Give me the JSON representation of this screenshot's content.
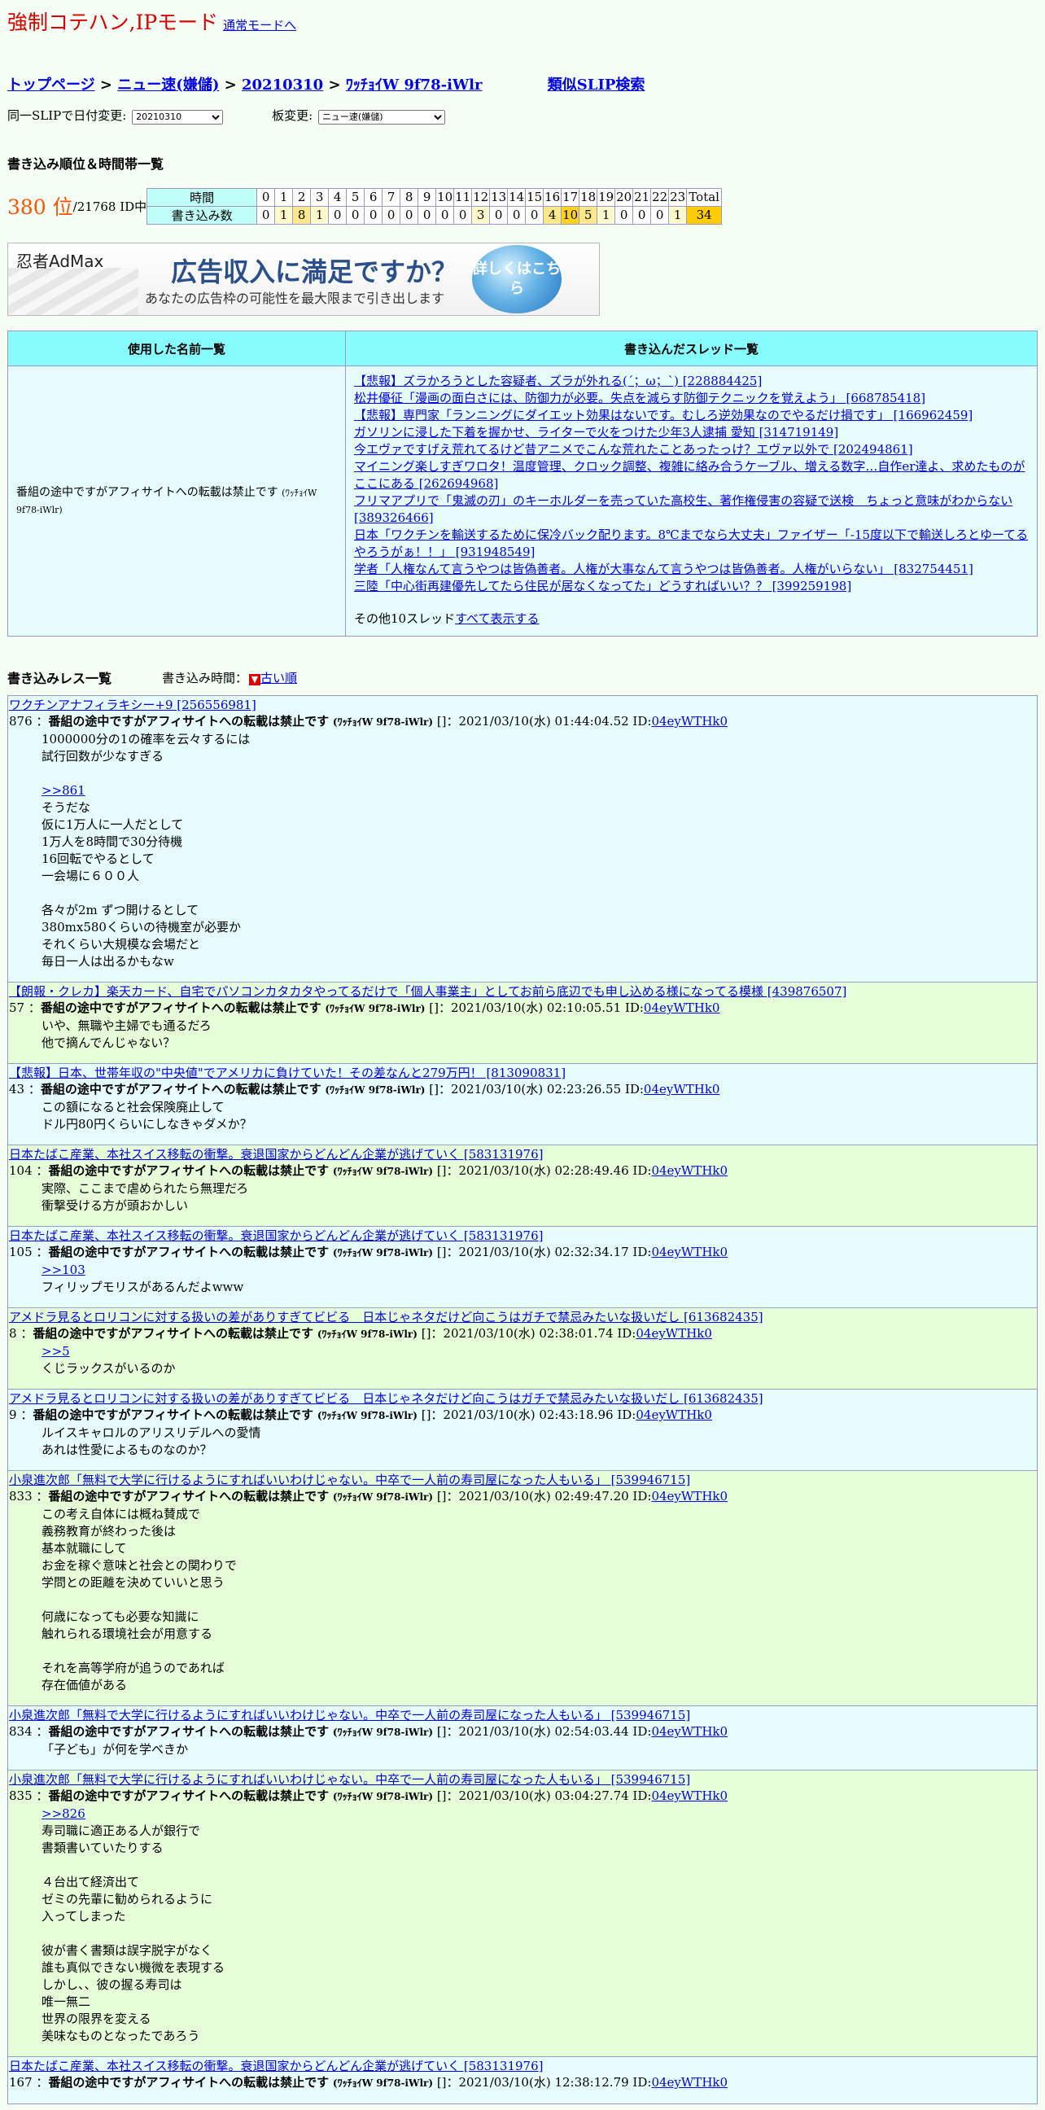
{
  "header": {
    "mode_title": "強制コテハン,IPモード",
    "mode_link": "通常モードへ"
  },
  "breadcrumb": {
    "top": "トップページ",
    "board": "ニュー速(嫌儲)",
    "date": "20210310",
    "slip": "ﾜｯﾁｮｲW 9f78-iWlr",
    "similar": "類似SLIP検索",
    "sep": ">"
  },
  "controls": {
    "date_label": "同一SLIPで日付変更:",
    "date_value": "20210310",
    "board_label": "板変更:",
    "board_value": "ニュー速(嫌儲)"
  },
  "ranking": {
    "section_title": "書き込み順位＆時間帯一覧",
    "rank": "380 位",
    "of": "/21768 ID中",
    "row_time_label": "時間",
    "row_count_label": "書き込み数",
    "hours": [
      "0",
      "1",
      "2",
      "3",
      "4",
      "5",
      "6",
      "7",
      "8",
      "9",
      "10",
      "11",
      "12",
      "13",
      "14",
      "15",
      "16",
      "17",
      "18",
      "19",
      "20",
      "21",
      "22",
      "23",
      "Total"
    ],
    "counts": [
      "0",
      "1",
      "8",
      "1",
      "0",
      "0",
      "0",
      "0",
      "0",
      "0",
      "0",
      "0",
      "3",
      "0",
      "0",
      "0",
      "4",
      "10",
      "5",
      "1",
      "0",
      "0",
      "0",
      "1",
      "34"
    ]
  },
  "ad": {
    "logo": "忍者AdMax",
    "title": "広告収入に満足ですか？",
    "subtitle": "あなたの広告枠の可能性を最大限まで引き出します",
    "button": "詳しくはこちら"
  },
  "names_table": {
    "col_names": "使用した名前一覧",
    "col_threads": "書き込んだスレッド一覧",
    "name": "番組の途中ですがアフィサイトへの転載は禁止です",
    "name_slip": "(ﾜｯﾁｮｲW 9f78-iWlr)",
    "threads": [
      "【悲報】ズラかろうとした容疑者、ズラが外れる(´；ω；`) [228884425]",
      "松井優征「漫画の面白さには、防御力が必要。失点を減らす防御テクニックを覚えよう」 [668785418]",
      "【悲報】専門家「ランニングにダイエット効果はないです。むしろ逆効果なのでやるだけ損です」 [166962459]",
      "ガソリンに浸した下着を握かせ、ライターで火をつけた少年3人逮捕 愛知 [314719149]",
      "今エヴァですげえ荒れてるけど昔アニメでこんな荒れたことあったっけ？エヴァ以外で [202494861]",
      "マイニング楽しすぎワロタ！温度管理、クロック調整、複雑に絡み合うケーブル、増える数字…自作er達よ、求めたものがここにある [262694968]",
      "フリマアプリで「鬼滅の刃」のキーホルダーを売っていた高校生、著作権侵害の容疑で送検　ちょっと意味がわからない [389326466]",
      "日本「ワクチンを輸送するために保冷バック配ります。8℃までなら大丈夫」ファイザー「-15度以下で輸送しろとゆーてるやろうがぁ！！」 [931948549]",
      "学者「人権なんて言うやつは皆偽善者。人権が大事なんて言うやつは皆偽善者。人権がいらない」 [832754451]",
      "三陸「中心街再建優先してたら住民が居なくなってた」どうすればいい？？ [399259198]"
    ],
    "more_prefix": "その他10スレッド",
    "more_link": "すべて表示する"
  },
  "posts_header": {
    "title": "書き込みレス一覧",
    "time_label": "書き込み時間：",
    "sort_icon": "▼",
    "sort_link": "古い順"
  },
  "posts": [
    {
      "thread": "ワクチンアナフィラキシー+9 [256556981]",
      "num": "876",
      "name": "番組の途中ですがアフィサイトへの転載は禁止です",
      "slip": "(ﾜｯﾁｮｲW 9f78-iWlr)",
      "mid": "[]：2021/03/10(水) 01:44:04.52 ID:",
      "id": "04eyWTHk0",
      "ref": "",
      "lines": [
        "1000000分の1の確率を云々するには",
        "試行回数が少なすぎる"
      ],
      "ref2": ">>861",
      "lines2": [
        "そうだな",
        "仮に1万人に一人だとして",
        "1万人を8時間で30分待機",
        "16回転でやるとして",
        "一会場に６００人",
        "",
        "各々が2m ずつ開けるとして",
        "380mx580くらいの待機室が必要か",
        "それくらい大規模な会場だと",
        "毎日一人は出るかもなw"
      ]
    },
    {
      "thread": "【朗報・クレカ】楽天カード、自宅でパソコンカタカタやってるだけで「個人事業主」としてお前ら底辺でも申し込める様になってる模様 [439876507]",
      "num": "57",
      "name": "番組の途中ですがアフィサイトへの転載は禁止です",
      "slip": "(ﾜｯﾁｮｲW 9f78-iWlr)",
      "mid": "[]：2021/03/10(水) 02:10:05.51 ID:",
      "id": "04eyWTHk0",
      "ref": "",
      "lines": [
        "いや、無職や主婦でも通るだろ",
        "他で摘んでんじゃない？"
      ],
      "ref2": "",
      "lines2": []
    },
    {
      "thread": "【悲報】日本、世帯年収の\"中央値\"でアメリカに負けていた！その差なんと279万円！ [813090831]",
      "num": "43",
      "name": "番組の途中ですがアフィサイトへの転載は禁止です",
      "slip": "(ﾜｯﾁｮｲW 9f78-iWlr)",
      "mid": "[]：2021/03/10(水) 02:23:26.55 ID:",
      "id": "04eyWTHk0",
      "ref": "",
      "lines": [
        "この額になると社会保険廃止して",
        "ドル円80円くらいにしなきゃダメか？"
      ],
      "ref2": "",
      "lines2": []
    },
    {
      "thread": "日本たばこ産業、本社スイス移転の衝撃。衰退国家からどんどん企業が逃げていく [583131976]",
      "num": "104",
      "name": "番組の途中ですがアフィサイトへの転載は禁止です",
      "slip": "(ﾜｯﾁｮｲW 9f78-iWlr)",
      "mid": "[]：2021/03/10(水) 02:28:49.46 ID:",
      "id": "04eyWTHk0",
      "ref": "",
      "lines": [
        "実際、ここまで虐められたら無理だろ",
        "衝撃受ける方が頭おかしい"
      ],
      "ref2": "",
      "lines2": []
    },
    {
      "thread": "日本たばこ産業、本社スイス移転の衝撃。衰退国家からどんどん企業が逃げていく [583131976]",
      "num": "105",
      "name": "番組の途中ですがアフィサイトへの転載は禁止です",
      "slip": "(ﾜｯﾁｮｲW 9f78-iWlr)",
      "mid": "[]：2021/03/10(水) 02:32:34.17 ID:",
      "id": "04eyWTHk0",
      "ref": ">>103",
      "lines": [
        "フィリップモリスがあるんだよwww"
      ],
      "ref2": "",
      "lines2": []
    },
    {
      "thread": "アメドラ見るとロリコンに対する扱いの差がありすぎてビビる　日本じゃネタだけど向こうはガチで禁忌みたいな扱いだし [613682435]",
      "num": "8",
      "name": "番組の途中ですがアフィサイトへの転載は禁止です",
      "slip": "(ﾜｯﾁｮｲW 9f78-iWlr)",
      "mid": "[]：2021/03/10(水) 02:38:01.74 ID:",
      "id": "04eyWTHk0",
      "ref": ">>5",
      "lines": [
        "くじラックスがいるのか"
      ],
      "ref2": "",
      "lines2": []
    },
    {
      "thread": "アメドラ見るとロリコンに対する扱いの差がありすぎてビビる　日本じゃネタだけど向こうはガチで禁忌みたいな扱いだし [613682435]",
      "num": "9",
      "name": "番組の途中ですがアフィサイトへの転載は禁止です",
      "slip": "(ﾜｯﾁｮｲW 9f78-iWlr)",
      "mid": "[]：2021/03/10(水) 02:43:18.96 ID:",
      "id": "04eyWTHk0",
      "ref": "",
      "lines": [
        "ルイスキャロルのアリスリデルへの愛情",
        "あれは性愛によるものなのか？"
      ],
      "ref2": "",
      "lines2": []
    },
    {
      "thread": "小泉進次郎「無料で大学に行けるようにすればいいわけじゃない。中卒で一人前の寿司屋になった人もいる」 [539946715]",
      "num": "833",
      "name": "番組の途中ですがアフィサイトへの転載は禁止です",
      "slip": "(ﾜｯﾁｮｲW 9f78-iWlr)",
      "mid": "[]：2021/03/10(水) 02:49:47.20 ID:",
      "id": "04eyWTHk0",
      "ref": "",
      "lines": [
        "この考え自体には概ね賛成で",
        "義務教育が終わった後は",
        "基本就職にして",
        "お金を稼ぐ意味と社会との関わりで",
        "学問との距離を決めていいと思う",
        "",
        "何歳になっても必要な知識に",
        "触れられる環境社会が用意する",
        "",
        "それを高等学府が追うのであれば",
        "存在価値がある"
      ],
      "ref2": "",
      "lines2": []
    },
    {
      "thread": "小泉進次郎「無料で大学に行けるようにすればいいわけじゃない。中卒で一人前の寿司屋になった人もいる」 [539946715]",
      "num": "834",
      "name": "番組の途中ですがアフィサイトへの転載は禁止です",
      "slip": "(ﾜｯﾁｮｲW 9f78-iWlr)",
      "mid": "[]：2021/03/10(水) 02:54:03.44 ID:",
      "id": "04eyWTHk0",
      "ref": "",
      "lines": [
        "「子ども」が何を学べきか"
      ],
      "ref2": "",
      "lines2": []
    },
    {
      "thread": "小泉進次郎「無料で大学に行けるようにすればいいわけじゃない。中卒で一人前の寿司屋になった人もいる」 [539946715]",
      "num": "835",
      "name": "番組の途中ですがアフィサイトへの転載は禁止です",
      "slip": "(ﾜｯﾁｮｲW 9f78-iWlr)",
      "mid": "[]：2021/03/10(水) 03:04:27.74 ID:",
      "id": "04eyWTHk0",
      "ref": ">>826",
      "lines": [
        "寿司職に適正ある人が銀行で",
        "書類書いていたりする",
        "",
        "４台出て経済出て",
        "ゼミの先輩に勧められるように",
        "入ってしまった",
        "",
        "彼が書く書類は誤字脱字がなく",
        "誰も真似できない機微を表現する",
        "しかし、、彼の握る寿司は",
        "唯一無二",
        "世界の限界を変える",
        "美味なものとなったであろう"
      ],
      "ref2": "",
      "lines2": []
    },
    {
      "thread": "日本たばこ産業、本社スイス移転の衝撃。衰退国家からどんどん企業が逃げていく [583131976]",
      "num": "167",
      "name": "番組の途中ですがアフィサイトへの転載は禁止です",
      "slip": "(ﾜｯﾁｮｲW 9f78-iWlr)",
      "mid": "[]：2021/03/10(水) 12:38:12.79 ID:",
      "id": "04eyWTHk0",
      "ref": "",
      "lines": [],
      "ref2": "",
      "lines2": []
    }
  ]
}
